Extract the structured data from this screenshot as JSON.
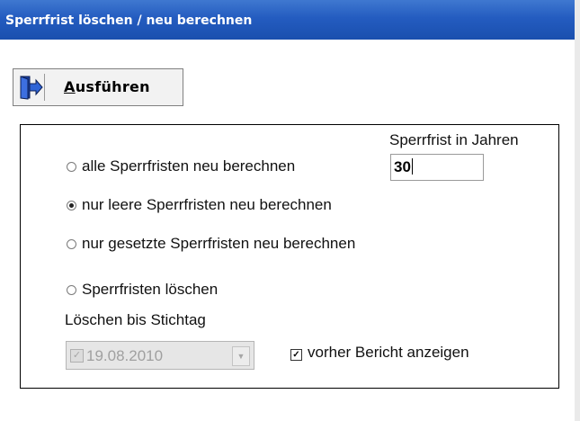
{
  "window": {
    "title": "Sperrfrist löschen / neu berechnen"
  },
  "toolbar": {
    "execute_prefix": "A",
    "execute_rest": "usführen",
    "icon": "exit-door-icon"
  },
  "options": {
    "group_label": "Sperrfrist in Jahren",
    "years_value": "30",
    "radio_all": "alle Sperrfristen neu berechnen",
    "radio_empty": "nur leere Sperrfristen neu berechnen",
    "radio_set": "nur gesetzte Sperrfristen neu berechnen",
    "radio_delete": "Sperrfristen löschen",
    "selected": "radio_empty",
    "delete_until_label": "Löschen bis Stichtag",
    "date_value": "19.08.2010",
    "date_enabled": false,
    "report_checkbox_label": "vorher  Bericht anzeigen",
    "report_checked": true
  }
}
